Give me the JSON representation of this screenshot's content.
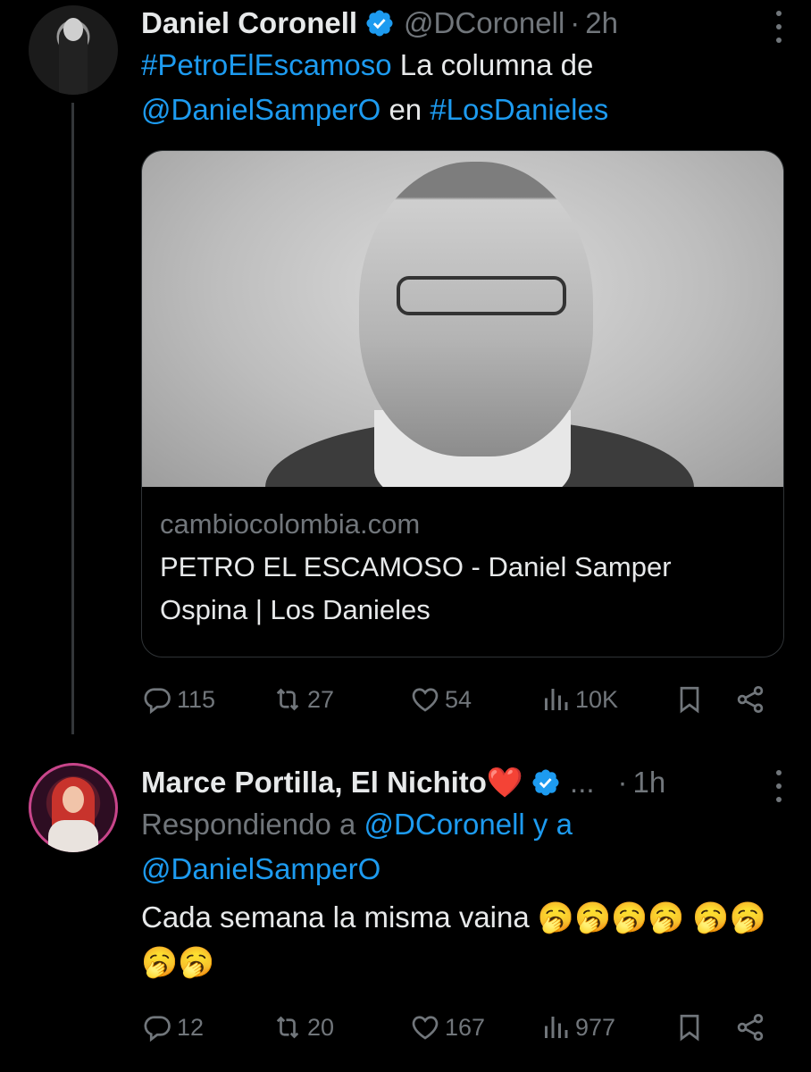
{
  "tweets": [
    {
      "author_name": "Daniel Coronell",
      "handle": "@DCoronell",
      "separator": "·",
      "time": "2h",
      "text": {
        "hashtag1": "#PetroElEscamoso",
        "plain1": " La columna de ",
        "mention1": "@DanielSamperO",
        "plain2": " en ",
        "hashtag2": "#LosDanieles"
      },
      "card": {
        "domain": "cambiocolombia.com",
        "title": "PETRO EL ESCAMOSO - Daniel Samper Ospina | Los Danieles"
      },
      "stats": {
        "replies": "115",
        "reposts": "27",
        "likes": "54",
        "views": "10K"
      }
    },
    {
      "author_name": "Marce Portilla, El Nichito❤️",
      "ellipsis": "...",
      "separator": "·",
      "time": "1h",
      "reply_to": {
        "prefix": "Respondiendo a ",
        "user1": "@DCoronell",
        "joiner": " y a",
        "user2": "@DanielSamperO"
      },
      "text": "Cada semana la misma vaina 🥱🥱🥱🥱 🥱🥱🥱🥱",
      "stats": {
        "replies": "12",
        "reposts": "20",
        "likes": "167",
        "views": "977"
      }
    }
  ],
  "icons": {
    "reply": "reply-icon",
    "repost": "repost-icon",
    "like": "heart-icon",
    "views": "views-icon",
    "bookmark": "bookmark-icon",
    "share": "share-icon",
    "verified": "verified-badge-icon",
    "more": "more-options-icon"
  },
  "colors": {
    "background": "#000000",
    "text": "#e7e9ea",
    "muted": "#71767b",
    "link": "#1d9bf0",
    "verified": "#1d9bf0"
  }
}
